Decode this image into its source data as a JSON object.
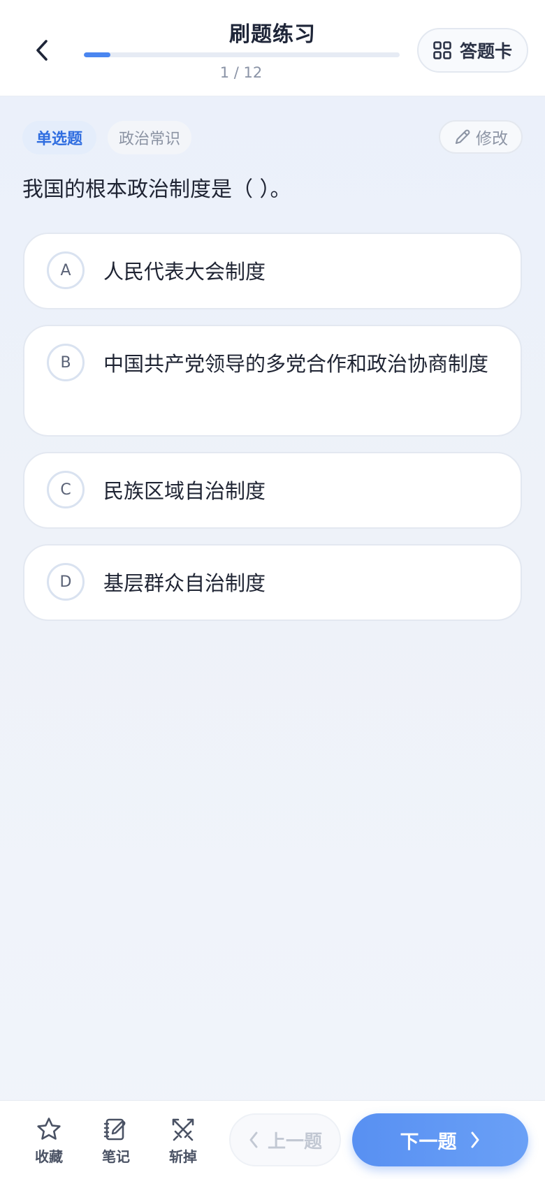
{
  "header": {
    "title": "刷题练习",
    "progress_text": "1 / 12",
    "progress": {
      "current": 1,
      "total": 12
    },
    "answer_card_label": "答题卡"
  },
  "question": {
    "type_tag": "单选题",
    "subject_tag": "政治常识",
    "edit_label": "修改",
    "stem": "我国的根本政治制度是（ ）。",
    "options": [
      {
        "letter": "A",
        "text": "人民代表大会制度"
      },
      {
        "letter": "B",
        "text": "中国共产党领导的多党合作和政治协商制度"
      },
      {
        "letter": "C",
        "text": "民族区域自治制度"
      },
      {
        "letter": "D",
        "text": "基层群众自治制度"
      }
    ]
  },
  "bottom_bar": {
    "favorite_label": "收藏",
    "note_label": "笔记",
    "remove_label": "斩掉",
    "prev_label": "上一题",
    "next_label": "下一题"
  },
  "colors": {
    "accent": "#4a86f0",
    "tag_bg": "#e4edfb",
    "next_button": "#5890f2"
  }
}
